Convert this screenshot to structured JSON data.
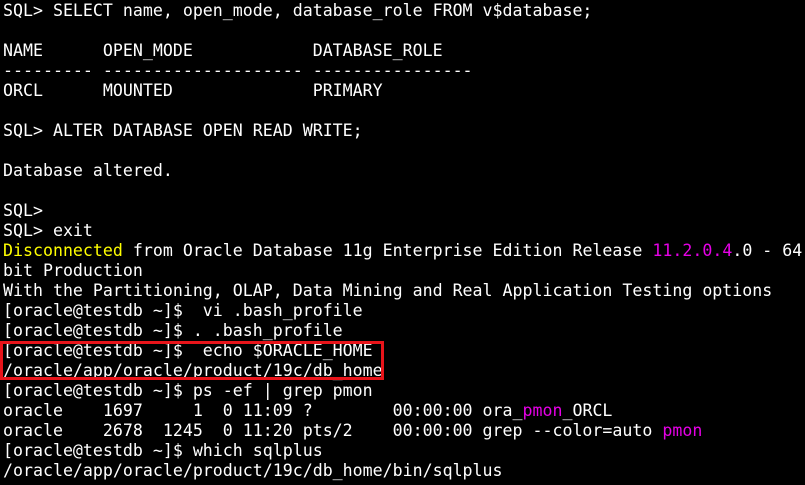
{
  "terminal": {
    "colors": {
      "background": "#000000",
      "text": "#ffffff",
      "highlight_yellow": "#ffff00",
      "highlight_magenta": "#e600e6",
      "annotation_box": "#e8141a"
    },
    "lines": [
      [
        {
          "t": "SQL> SELECT name, open_mode, database_role FROM v$database;"
        }
      ],
      [
        {
          "t": ""
        }
      ],
      [
        {
          "t": "NAME      OPEN_MODE            DATABASE_ROLE"
        }
      ],
      [
        {
          "t": "--------- -------------------- ----------------"
        }
      ],
      [
        {
          "t": "ORCL      MOUNTED              PRIMARY"
        }
      ],
      [
        {
          "t": ""
        }
      ],
      [
        {
          "t": "SQL> ALTER DATABASE OPEN READ WRITE;"
        }
      ],
      [
        {
          "t": ""
        }
      ],
      [
        {
          "t": "Database altered."
        }
      ],
      [
        {
          "t": ""
        }
      ],
      [
        {
          "t": "SQL>"
        }
      ],
      [
        {
          "t": "SQL> exit"
        }
      ],
      [
        {
          "t": "Disconnected",
          "c": "#ffff00"
        },
        {
          "t": " from Oracle Database 11g Enterprise Edition Release "
        },
        {
          "t": "11.2.0.4",
          "c": "#e600e6"
        },
        {
          "t": ".0 - 64"
        }
      ],
      [
        {
          "t": "bit Production"
        }
      ],
      [
        {
          "t": "With the Partitioning, OLAP, Data Mining and Real Application Testing options"
        }
      ],
      [
        {
          "t": "[oracle@testdb ~]$  vi .bash_profile"
        }
      ],
      [
        {
          "t": "[oracle@testdb ~]$ . .bash_profile"
        }
      ],
      [
        {
          "t": "[oracle@testdb ~]$  echo $ORACLE_HOME"
        }
      ],
      [
        {
          "t": "/oracle/app/oracle/product/19c/db_home"
        }
      ],
      [
        {
          "t": "[oracle@testdb ~]$ ps -ef | grep pmon"
        }
      ],
      [
        {
          "t": "oracle    1697     1  0 11:09 ?        00:00:00 ora_"
        },
        {
          "t": "pmon",
          "c": "#e600e6"
        },
        {
          "t": "_ORCL"
        }
      ],
      [
        {
          "t": "oracle    2678  1245  0 11:20 pts/2    00:00:00 grep --color=auto "
        },
        {
          "t": "pmon",
          "c": "#e600e6"
        }
      ],
      [
        {
          "t": "[oracle@testdb ~]$ which sqlplus"
        }
      ],
      [
        {
          "t": "/oracle/app/oracle/product/19c/db_home/bin/sqlplus"
        }
      ]
    ]
  }
}
